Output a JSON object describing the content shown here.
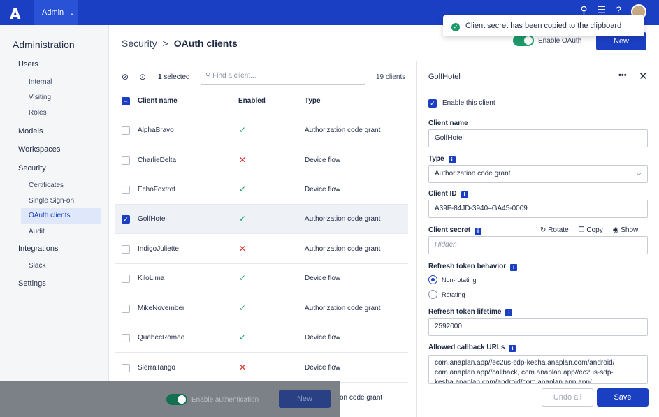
{
  "topbar": {
    "logo": "A",
    "app": "Admin",
    "chevron": "⌄"
  },
  "sidebar": {
    "title": "Administration",
    "users": "Users",
    "internal": "Internal",
    "visiting": "Visiting",
    "roles": "Roles",
    "models": "Models",
    "workspaces": "Workspaces",
    "security": "Security",
    "certificates": "Certificates",
    "sso": "Single Sign-on",
    "oauth": "OAuth clients",
    "audit": "Audit",
    "integrations": "Integrations",
    "slack": "Slack",
    "settings": "Settings"
  },
  "header": {
    "crumb_parent": "Security",
    "crumb_sep": ">",
    "crumb_current": "OAuth clients",
    "enable_oauth": "Enable OAuth",
    "new_button": "New"
  },
  "toast": {
    "message": "Client secret has been copied to the clipboard"
  },
  "list": {
    "selected_count": "1",
    "selected_label": "selected",
    "search_placeholder": "Find a client...",
    "total": "19 clients",
    "col_name": "Client name",
    "col_enabled": "Enabled",
    "col_type": "Type",
    "rows": [
      {
        "name": "AlphaBravo",
        "enabled": "✓",
        "type": "Authorization code grant"
      },
      {
        "name": "CharlieDelta",
        "enabled": "✕",
        "type": "Device flow"
      },
      {
        "name": "EchoFoxtrot",
        "enabled": "✓",
        "type": "Device flow"
      },
      {
        "name": "GolfHotel",
        "enabled": "✓",
        "type": "Authorization code grant"
      },
      {
        "name": "IndigoJuliette",
        "enabled": "✕",
        "type": "Authorization code grant"
      },
      {
        "name": "KiloLima",
        "enabled": "✓",
        "type": "Device flow"
      },
      {
        "name": "MikeNovember",
        "enabled": "✓",
        "type": "Authorization code grant"
      },
      {
        "name": "QuebecRomeo",
        "enabled": "✓",
        "type": "Device flow"
      },
      {
        "name": "SierraTango",
        "enabled": "✕",
        "type": "Device flow"
      }
    ]
  },
  "footer": {
    "enable_auth": "Enable authentication",
    "new_button": "New",
    "tail_text": "on code grant"
  },
  "panel": {
    "title": "GolfHotel",
    "more": "•••",
    "close": "✕",
    "enable_client": "Enable this client",
    "client_name_label": "Client name",
    "client_name_value": "GolfHotel",
    "type_label": "Type",
    "type_value": "Authorization code grant",
    "client_id_label": "Client ID",
    "client_id_value": "A39F-84JD-3940–GA45-0009",
    "client_secret_label": "Client secret",
    "rotate": "Rotate",
    "copy": "Copy",
    "show": "Show",
    "secret_placeholder": "Hidden",
    "refresh_behavior_label": "Refresh token behavior",
    "opt_non_rotating": "Non-rotating",
    "opt_rotating": "Rotating",
    "refresh_lifetime_label": "Refresh token lifetime",
    "refresh_lifetime_value": "2592000",
    "callback_label": "Allowed callback URLs",
    "callback_value": "com.anaplan.app//ec2us-sdp-kesha.anaplan.com/android/ com.anaplan.app//callback, com.anaplan.app//ec2us-sdp-kesha.anaplan.com/android/com.anaplan.app.app/",
    "undo": "Undo all",
    "save": "Save"
  }
}
